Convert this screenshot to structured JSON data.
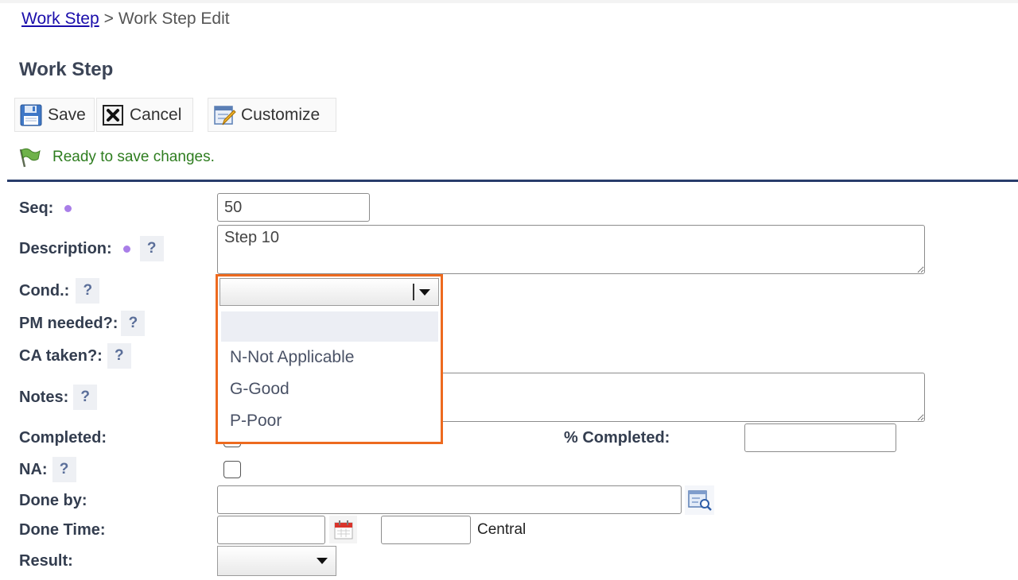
{
  "breadcrumb": {
    "link": "Work Step",
    "separator": ">",
    "current": "Work Step Edit"
  },
  "page_title": "Work Step",
  "toolbar": {
    "save": "Save",
    "cancel": "Cancel",
    "customize": "Customize"
  },
  "status": "Ready to save changes.",
  "fields": {
    "seq": {
      "label": "Seq:",
      "value": "50"
    },
    "description": {
      "label": "Description:",
      "value": "Step 10"
    },
    "cond": {
      "label": "Cond.:",
      "value": ""
    },
    "pm_needed": {
      "label": "PM needed?:"
    },
    "ca_taken": {
      "label": "CA taken?:"
    },
    "notes": {
      "label": "Notes:",
      "value": ""
    },
    "completed": {
      "label": "Completed:"
    },
    "pct_completed": {
      "label": "% Completed:",
      "value": ""
    },
    "na": {
      "label": "NA:"
    },
    "done_by": {
      "label": "Done by:",
      "value": ""
    },
    "done_time": {
      "label": "Done Time:",
      "date": "",
      "time": "",
      "timezone": "Central"
    },
    "result": {
      "label": "Result:",
      "value": ""
    }
  },
  "help_glyph": "?",
  "cond_options": [
    "",
    "N-Not Applicable",
    "G-Good",
    "P-Poor"
  ],
  "colors": {
    "highlight": "#ed6a1f",
    "divider": "#283c6b",
    "status": "#2e7d1f",
    "required_dot": "#a97ee8",
    "link": "#1a0dab"
  }
}
